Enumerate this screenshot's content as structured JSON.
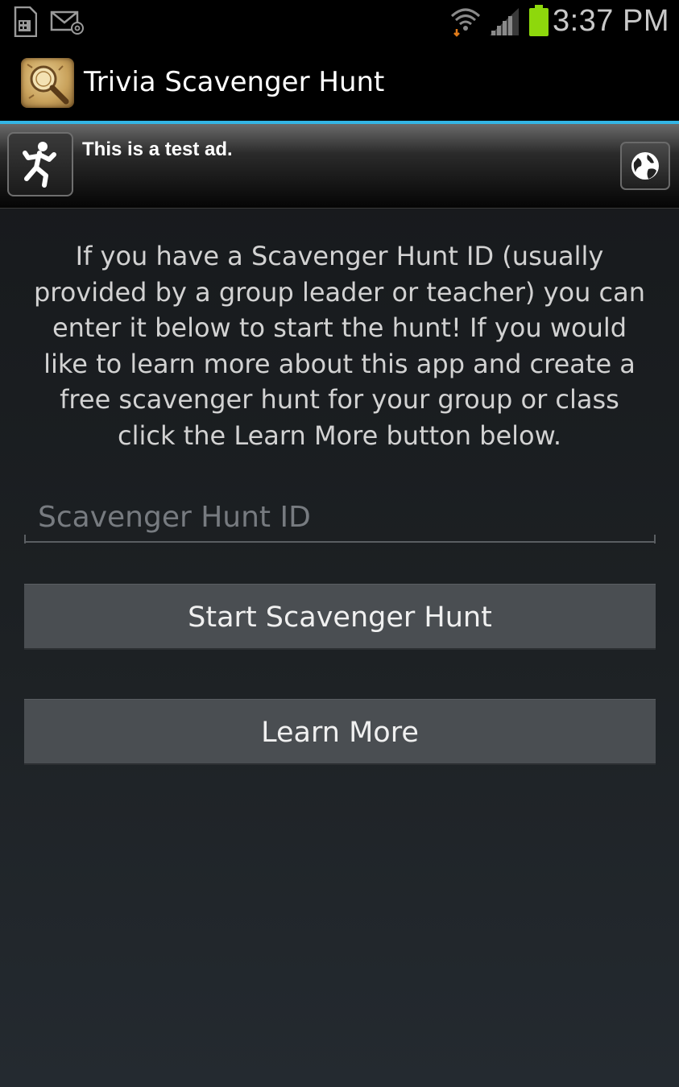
{
  "status_bar": {
    "time": "3:37 PM",
    "icons": [
      "sd-card-icon",
      "email-notification-icon",
      "wifi-icon",
      "signal-strength-icon",
      "battery-icon"
    ],
    "battery_color": "#8ed80c"
  },
  "action_bar": {
    "title": "Trivia Scavenger Hunt",
    "accent": "#33b5e5"
  },
  "ad_banner": {
    "text": "This is a test ad.",
    "icons": [
      "running-man-icon",
      "globe-icon"
    ]
  },
  "main": {
    "intro_text": "If you have a Scavenger Hunt ID (usually\nprovided by a group leader or teacher) you can\nenter it below to start the hunt!  If you would\nlike to learn more about this app and create a\nfree scavenger hunt for your group or class\nclick the Learn More button below.",
    "hunt_id_input": {
      "value": "",
      "placeholder": "Scavenger Hunt ID"
    },
    "start_button_label": "Start Scavenger Hunt",
    "learn_more_button_label": "Learn More"
  }
}
